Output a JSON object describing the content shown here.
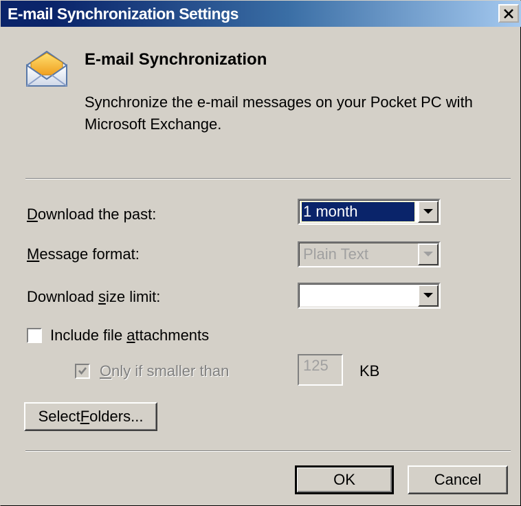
{
  "window": {
    "title": "E-mail Synchronization Settings"
  },
  "header": {
    "title": "E-mail Synchronization",
    "description": "Synchronize the e-mail messages on your Pocket PC with Microsoft Exchange.",
    "icon": "envelope-icon"
  },
  "form": {
    "download_past": {
      "label_pre": "",
      "label_key": "D",
      "label_post": "ownload the past:",
      "value": "1 month"
    },
    "message_format": {
      "label_pre": "",
      "label_key": "M",
      "label_post": "essage format:",
      "value": "Plain Text"
    },
    "download_size": {
      "label_pre": "Download ",
      "label_key": "s",
      "label_post": "ize limit:",
      "value": ""
    },
    "include_attachments": {
      "label_pre": "Include file ",
      "label_key": "a",
      "label_post": "ttachments",
      "checked": false
    },
    "only_if_smaller": {
      "label_pre": "",
      "label_key": "O",
      "label_post": "nly if smaller than",
      "checked": true,
      "value": "125",
      "unit": "KB"
    }
  },
  "buttons": {
    "select_folders_pre": "Select ",
    "select_folders_key": "F",
    "select_folders_post": "olders...",
    "ok": "OK",
    "cancel": "Cancel"
  },
  "colors": {
    "titlebar_start": "#0a246a",
    "titlebar_end": "#a6caf0",
    "face": "#d4d0c8",
    "selection": "#0a246a"
  }
}
